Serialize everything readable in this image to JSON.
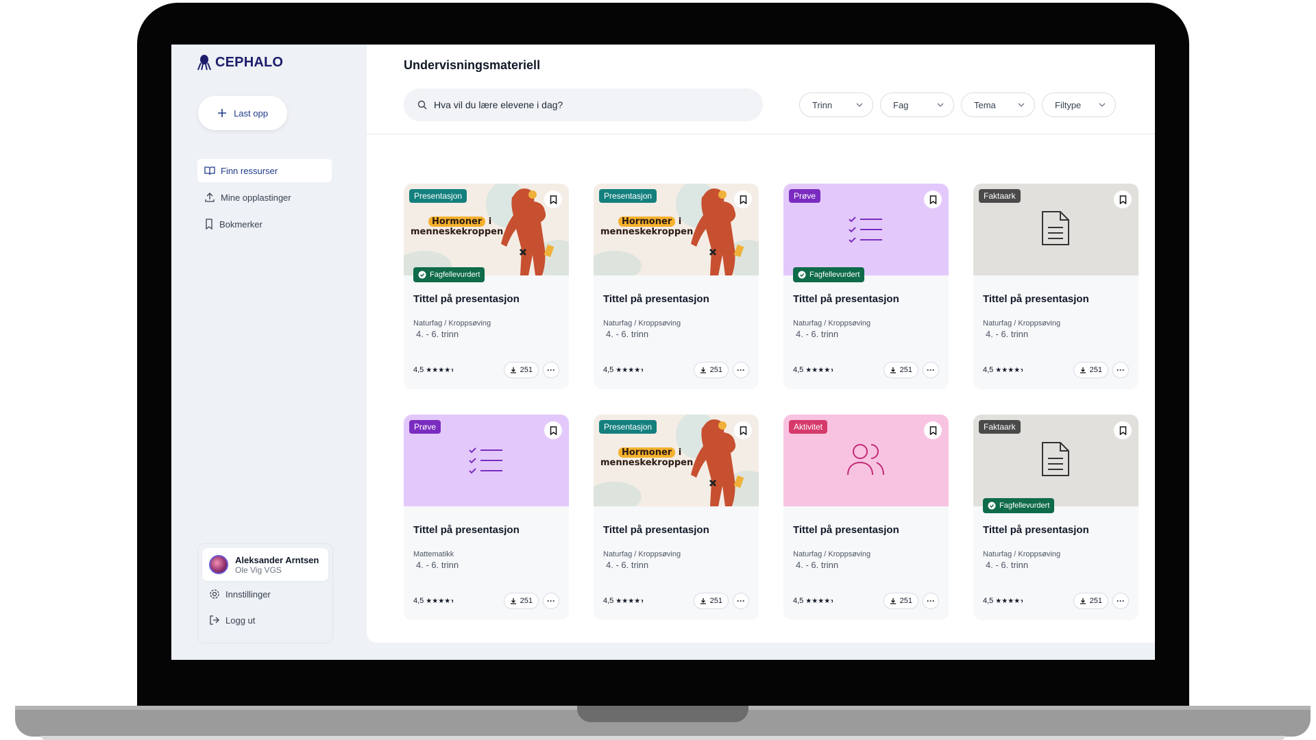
{
  "app": {
    "brand": "CEPHALO"
  },
  "sidebar": {
    "upload_label": "Last opp",
    "nav": [
      {
        "label": "Finn ressurser",
        "icon": "book-open-icon",
        "active": true
      },
      {
        "label": "Mine opplastinger",
        "icon": "upload-icon",
        "active": false
      },
      {
        "label": "Bokmerker",
        "icon": "bookmark-icon",
        "active": false
      }
    ],
    "user": {
      "name": "Aleksander Arntsen",
      "school": "Ole Vig VGS"
    },
    "settings_label": "Innstillinger",
    "logout_label": "Logg ut"
  },
  "header": {
    "title": "Undervisningsmateriell",
    "search_placeholder": "Hva vil du lære elevene i dag?",
    "filters": [
      "Trinn",
      "Fag",
      "Tema",
      "Filtype"
    ]
  },
  "illustration": {
    "word1": "Hormoner",
    "word2": "i",
    "line2": "menneskekroppen"
  },
  "cards": [
    {
      "tag": "Presentasjon",
      "tag_color": "#14807e",
      "thumb": "photo",
      "peer": "Fagfellevurdert",
      "title": "Tittel på presentasjon",
      "subject": "Naturfag / Kroppsøving",
      "grade": "4. - 6. trinn",
      "rating": "4,5",
      "downloads": "251"
    },
    {
      "tag": "Presentasjon",
      "tag_color": "#14807e",
      "thumb": "photo",
      "peer": "",
      "title": "Tittel på presentasjon",
      "subject": "Naturfag / Kroppsøving",
      "grade": "4. - 6. trinn",
      "rating": "4,5",
      "downloads": "251"
    },
    {
      "tag": "Prøve",
      "tag_color": "#7b2cc0",
      "thumb": "purple",
      "peer": "Fagfellevurdert",
      "title": "Tittel på presentasjon",
      "subject": "Naturfag / Kroppsøving",
      "grade": "4. - 6. trinn",
      "rating": "4,5",
      "downloads": "251"
    },
    {
      "tag": "Faktaark",
      "tag_color": "#4a4a4a",
      "thumb": "gray",
      "peer": "",
      "title": "Tittel på presentasjon",
      "subject": "Naturfag / Kroppsøving",
      "grade": "4. - 6. trinn",
      "rating": "4,5",
      "downloads": "251"
    },
    {
      "tag": "Prøve",
      "tag_color": "#7b2cc0",
      "thumb": "purple",
      "peer": "",
      "title": "Tittel på presentasjon",
      "subject": "Mattematikk",
      "grade": "4. - 6. trinn",
      "rating": "4,5",
      "downloads": "251"
    },
    {
      "tag": "Presentasjon",
      "tag_color": "#14807e",
      "thumb": "photo",
      "peer": "",
      "title": "Tittel på presentasjon",
      "subject": "Naturfag / Kroppsøving",
      "grade": "4. - 6. trinn",
      "rating": "4,5",
      "downloads": "251"
    },
    {
      "tag": "Aktivitet",
      "tag_color": "#d63a6a",
      "thumb": "pink",
      "peer": "",
      "title": "Tittel på presentasjon",
      "subject": "Naturfag / Kroppsøving",
      "grade": "4. - 6. trinn",
      "rating": "4,5",
      "downloads": "251"
    },
    {
      "tag": "Faktaark",
      "tag_color": "#4a4a4a",
      "thumb": "gray",
      "peer": "Fagfellevurdert",
      "title": "Tittel på presentasjon",
      "subject": "Naturfag / Kroppsøving",
      "grade": "4. - 6. trinn",
      "rating": "4,5",
      "downloads": "251"
    }
  ]
}
